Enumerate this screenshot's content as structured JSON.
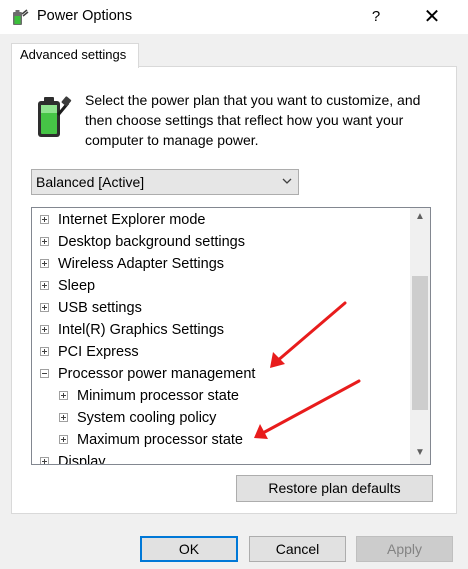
{
  "window": {
    "title": "Power Options",
    "help_label": "?",
    "close_label": "✕"
  },
  "tab": {
    "label": "Advanced settings"
  },
  "description": "Select the power plan that you want to customize, and then choose settings that reflect how you want your computer to manage power.",
  "plan_select": {
    "value": "Balanced [Active]"
  },
  "tree": {
    "items": [
      {
        "label": "Internet Explorer mode",
        "expanded": false
      },
      {
        "label": "Desktop background settings",
        "expanded": false
      },
      {
        "label": "Wireless Adapter Settings",
        "expanded": false
      },
      {
        "label": "Sleep",
        "expanded": false
      },
      {
        "label": "USB settings",
        "expanded": false
      },
      {
        "label": "Intel(R) Graphics Settings",
        "expanded": false
      },
      {
        "label": "PCI Express",
        "expanded": false
      },
      {
        "label": "Processor power management",
        "expanded": true
      },
      {
        "label": "Minimum processor state",
        "expanded": false
      },
      {
        "label": "System cooling policy",
        "expanded": false
      },
      {
        "label": "Maximum processor state",
        "expanded": false
      },
      {
        "label": "Display",
        "expanded": false
      }
    ]
  },
  "scrollbar": {
    "up": "▲",
    "down": "▼"
  },
  "buttons": {
    "restore": "Restore plan defaults",
    "ok": "OK",
    "cancel": "Cancel",
    "apply": "Apply"
  },
  "colors": {
    "annotation_arrow": "#e81c1c",
    "focus_border": "#0078d7"
  }
}
